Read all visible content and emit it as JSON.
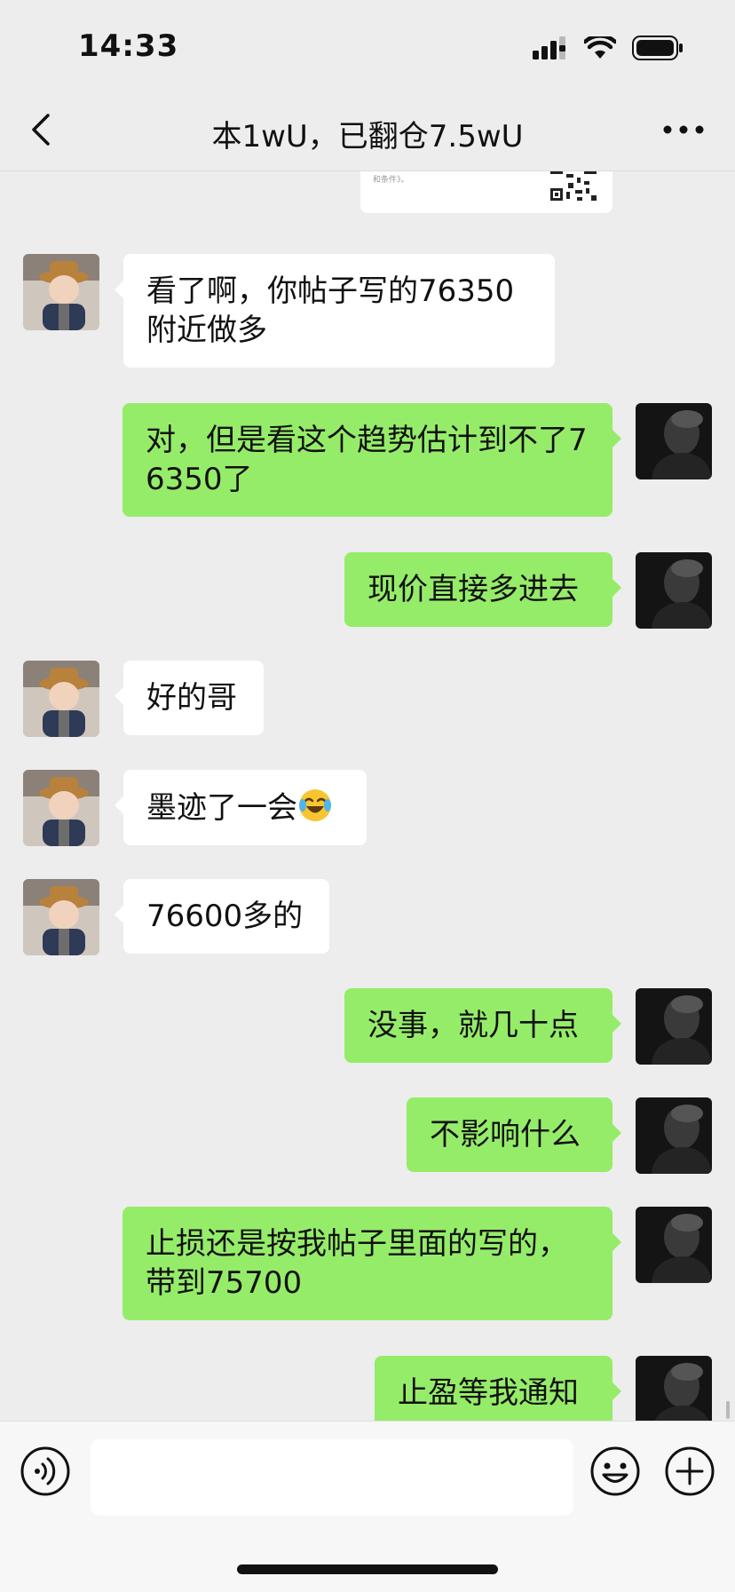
{
  "status_bar": {
    "time": "14:33"
  },
  "nav": {
    "title": "本1wU，已翻仓7.5wU"
  },
  "top_card": {
    "fine_print": "免责声明：该第三方内容，仅供参考，详见《条款和条件》。"
  },
  "messages": [
    {
      "side": "in",
      "text": "看了啊，你帖子写的76350附近做多"
    },
    {
      "side": "out",
      "text": "对，但是看这个趋势估计到不了76350了"
    },
    {
      "side": "out",
      "text": "现价直接多进去"
    },
    {
      "side": "in",
      "text": "好的哥"
    },
    {
      "side": "in",
      "text": "墨迹了一会",
      "emoji": "face-with-tears-of-joy-icon"
    },
    {
      "side": "in",
      "text": "76600多的"
    },
    {
      "side": "out",
      "text": "没事，就几十点"
    },
    {
      "side": "out",
      "text": "不影响什么"
    },
    {
      "side": "out",
      "text": "止损还是按我帖子里面的写的，带到75700"
    },
    {
      "side": "out",
      "text": "止盈等我通知"
    }
  ],
  "input_bar": {
    "placeholder": ""
  },
  "colors": {
    "background": "#ededed",
    "outgoing_bubble": "#95ec69",
    "incoming_bubble": "#ffffff"
  }
}
